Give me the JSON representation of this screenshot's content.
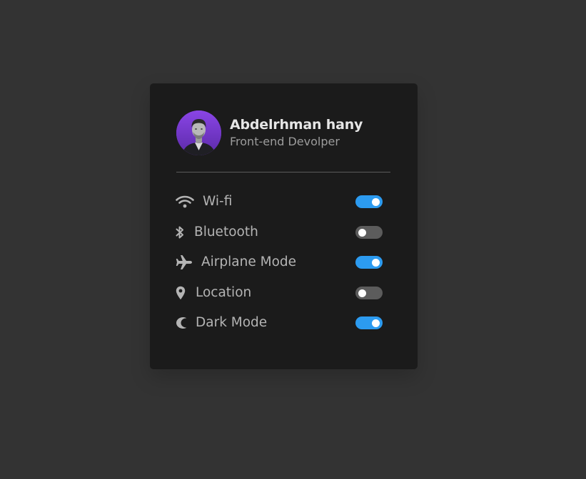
{
  "profile": {
    "name": "Abdelrhman hany",
    "role": "Front-end Devolper"
  },
  "settings": [
    {
      "label": "Wi-fi",
      "icon": "wifi-icon",
      "enabled": true
    },
    {
      "label": "Bluetooth",
      "icon": "bluetooth-icon",
      "enabled": false
    },
    {
      "label": "Airplane Mode",
      "icon": "airplane-icon",
      "enabled": true
    },
    {
      "label": "Location",
      "icon": "location-icon",
      "enabled": false
    },
    {
      "label": "Dark Mode",
      "icon": "moon-icon",
      "enabled": true
    }
  ],
  "colors": {
    "background": "#333333",
    "card": "#1b1b1b",
    "toggle_on": "#2c9bf0",
    "toggle_off": "#5c5c5c",
    "avatar_bg": "#7a3fd6"
  }
}
